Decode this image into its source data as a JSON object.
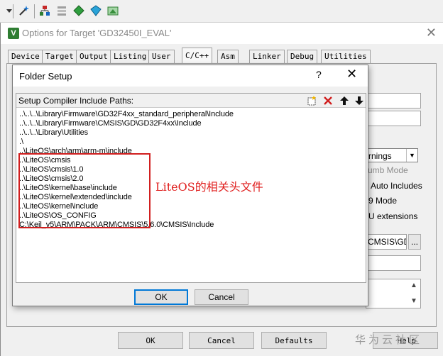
{
  "toolbar": {
    "icons": [
      "wand-icon",
      "build-tree-icon",
      "layers-icon",
      "green-diamond-icon",
      "blue-diamond-icon",
      "pack-installer-icon"
    ]
  },
  "options_window": {
    "title": "Options for Target 'GD32450I_EVAL'",
    "tabs": [
      {
        "label": "Device"
      },
      {
        "label": "Target"
      },
      {
        "label": "Output"
      },
      {
        "label": "Listing"
      },
      {
        "label": "User"
      },
      {
        "label": "C/C++",
        "active": true
      },
      {
        "label": "Asm"
      },
      {
        "label": "Linker"
      },
      {
        "label": "Debug"
      },
      {
        "label": "Utilities"
      }
    ],
    "right_controls": {
      "warnings_value": "rnings",
      "thumb_mode": "umb Mode",
      "auto_includes": "Auto Includes",
      "c99_mode": "9 Mode",
      "gnu_extensions": "U extensions",
      "include_paths_value": "CMSIS\\GD",
      "browse_label": "..."
    },
    "buttons": {
      "ok": "OK",
      "cancel": "Cancel",
      "defaults": "Defaults",
      "help": "Help"
    }
  },
  "watermark": "华为云社区",
  "folder_setup": {
    "title": "Folder Setup",
    "help_label": "?",
    "close_label": "✕",
    "header": "Setup Compiler Include Paths:",
    "paths": [
      "..\\..\\..\\Library\\Firmware\\GD32F4xx_standard_peripheral\\Include",
      "..\\..\\..\\Library\\Firmware\\CMSIS\\GD\\GD32F4xx\\Include",
      "..\\..\\..\\Library\\Utilities",
      ".\\",
      "..\\LiteOS\\arch\\arm\\arm-m\\include",
      "..\\LiteOS\\cmsis",
      "..\\LiteOS\\cmsis\\1.0",
      "..\\LiteOS\\cmsis\\2.0",
      "..\\LiteOS\\kernel\\base\\include",
      "..\\LiteOS\\kernel\\extended\\include",
      "..\\LiteOS\\kernel\\include",
      "..\\LiteOS\\OS_CONFIG",
      "C:\\Keil_v5\\ARM\\PACK\\ARM\\CMSIS\\5.6.0\\CMSIS\\Include"
    ],
    "annotation": "LiteOS的相关头文件",
    "ok": "OK",
    "cancel": "Cancel",
    "colors": {
      "highlight": "#d11f1f",
      "annotation": "#e0201f",
      "delete_icon": "#d11f1f"
    }
  }
}
